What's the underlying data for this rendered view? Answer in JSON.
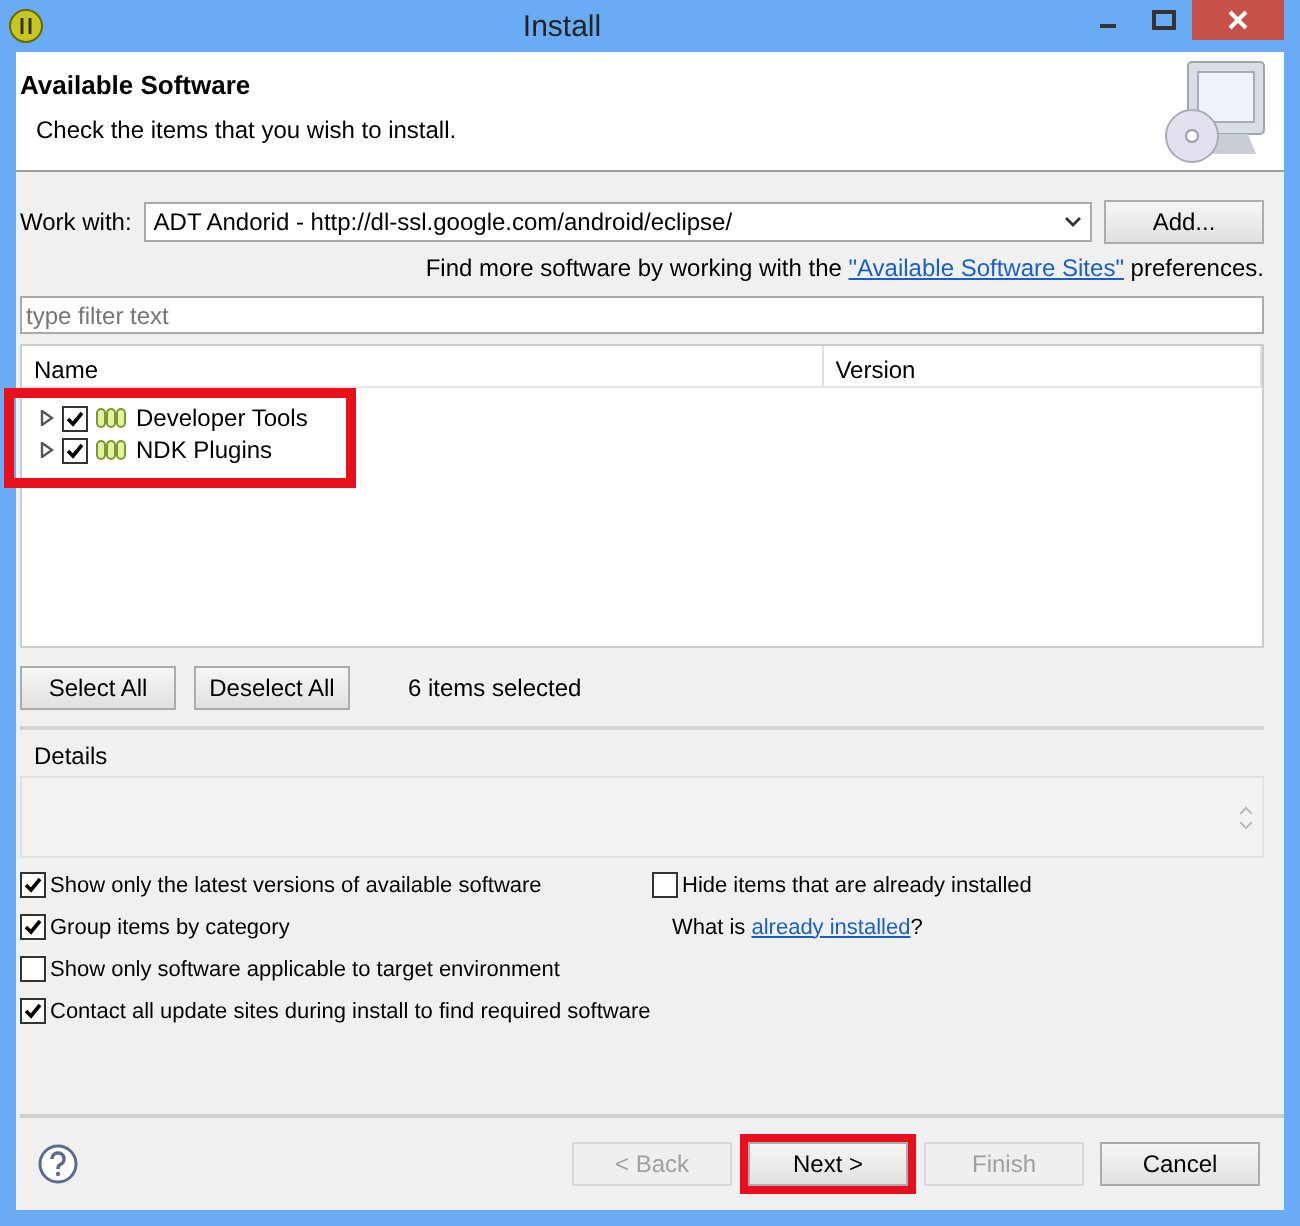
{
  "window": {
    "title": "Install"
  },
  "header": {
    "title": "Available Software",
    "subtitle": "Check the items that you wish to install."
  },
  "work_with": {
    "label": "Work with:",
    "value": "ADT Andorid - http://dl-ssl.google.com/android/eclipse/",
    "add_button": "Add..."
  },
  "sites_note": {
    "before": "Find more software by working with the ",
    "link": "\"Available Software Sites\"",
    "after": " preferences."
  },
  "filter": {
    "placeholder": "type filter text"
  },
  "tree": {
    "highlighted": true,
    "columns": [
      "Name",
      "Version"
    ],
    "items": [
      {
        "label": "Developer Tools",
        "checked": true,
        "expanded": false
      },
      {
        "label": "NDK Plugins",
        "checked": true,
        "expanded": false
      }
    ]
  },
  "selection": {
    "buttons": [
      "Select All",
      "Deselect All"
    ],
    "status": "6 items selected"
  },
  "details": {
    "label": "Details"
  },
  "options_left": [
    {
      "label": "Show only the latest versions of available software",
      "checked": true
    },
    {
      "label": "Group items by category",
      "checked": true
    },
    {
      "label": "Show only software applicable to target environment",
      "checked": false
    },
    {
      "label": "Contact all update sites during install to find required software",
      "checked": true
    }
  ],
  "options_right": {
    "hide": {
      "label": "Hide items that are already installed",
      "checked": false
    },
    "what_is": {
      "before": "What is ",
      "link": "already installed",
      "after": "?"
    }
  },
  "footer_buttons": [
    {
      "label": "< Back",
      "disabled": true,
      "highlighted": false
    },
    {
      "label": "Next >",
      "disabled": false,
      "highlighted": true
    },
    {
      "label": "Finish",
      "disabled": true,
      "highlighted": false
    },
    {
      "label": "Cancel",
      "disabled": false,
      "highlighted": false
    }
  ]
}
